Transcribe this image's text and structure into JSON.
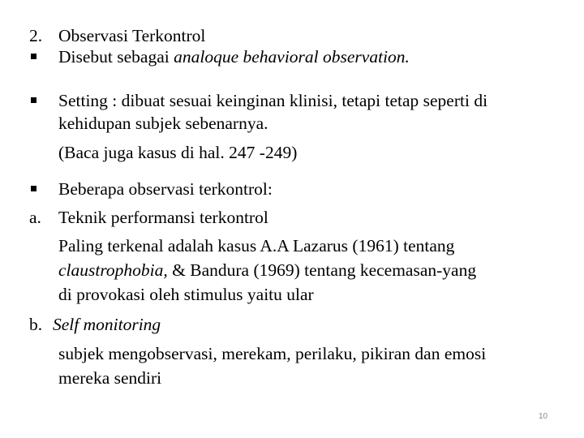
{
  "slide": {
    "heading": {
      "marker": "2.",
      "text": "Observasi Terkontrol"
    },
    "bullet1": {
      "text_plain": "Disebut sebagai ",
      "text_italic": "analoque behavioral observation."
    },
    "bullet2": {
      "line1": "Setting : dibuat sesuai keinginan klinisi, tetapi tetap seperti di",
      "line2": "kehidupan subjek sebenarnya.",
      "line3": "(Baca juga kasus di hal. 247 -249)"
    },
    "bullet3": {
      "text": "Beberapa observasi terkontrol:"
    },
    "item_a": {
      "marker": "a.",
      "title": "Teknik performansi terkontrol",
      "line1": "Paling terkenal adalah kasus A.A Lazarus (1961) tentang",
      "line2_italic": "claustrophobia,",
      "line2_plain": " & Bandura (1969) tentang kecemasan-yang",
      "line3": "di provokasi oleh stimulus yaitu ular"
    },
    "item_b": {
      "marker": "b.",
      "title_italic": "Self monitoring",
      "line1": "subjek mengobservasi, merekam, perilaku, pikiran dan emosi",
      "line2": "mereka sendiri"
    },
    "page_number": "10"
  }
}
